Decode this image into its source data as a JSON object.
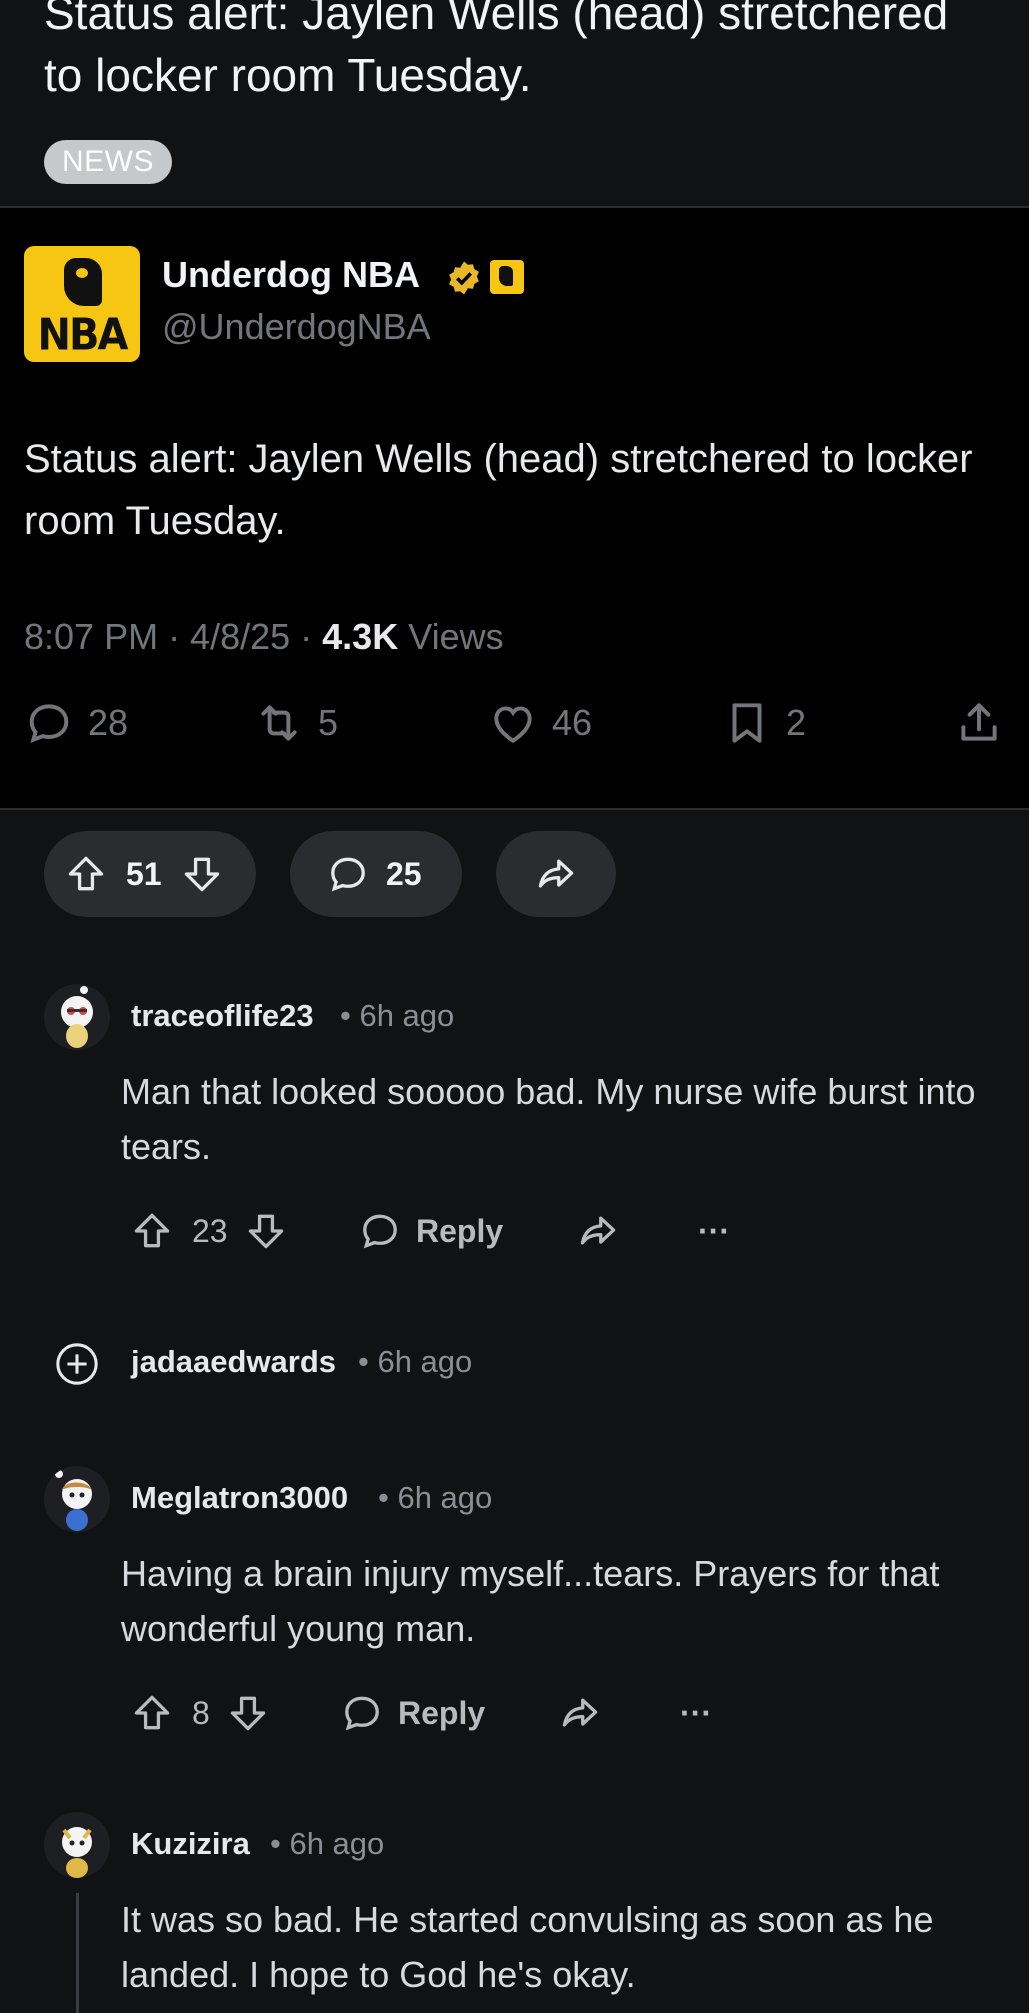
{
  "post": {
    "title": "Status alert: Jaylen Wells (head) stretchered to locker room Tuesday.",
    "flair": "NEWS"
  },
  "embed": {
    "logo_text": "NBA",
    "account_name": "Underdog NBA",
    "handle": "@UnderdogNBA",
    "text": "Status alert: Jaylen Wells (head) stretchered to locker room Tuesday.",
    "time": "8:07 PM · 4/8/25 · ",
    "views_count": "4.3K",
    "views_label": " Views",
    "replies": "28",
    "reposts": "5",
    "likes": "46",
    "bookmarks": "2",
    "colors": {
      "brand": "#f7c613",
      "verified": "#e8b829"
    }
  },
  "post_actions": {
    "votes": "51",
    "comments": "25"
  },
  "comments": [
    {
      "username": "traceoflife23",
      "age": "• 6h ago",
      "text": "Man that looked sooooo bad. My nurse wife burst into tears.",
      "votes": "23",
      "reply_label": "Reply",
      "more": "···"
    },
    {
      "username": "jadaaedwards",
      "age": "• 6h ago",
      "collapsed": true
    },
    {
      "username": "Meglatron3000",
      "age": "• 6h ago",
      "text": "Having a brain injury myself...tears. Prayers for that wonderful young man.",
      "votes": "8",
      "reply_label": "Reply",
      "more": "···"
    },
    {
      "username": "Kuzizira",
      "age": "• 6h ago",
      "text": "It was so bad. He started convulsing as soon as he landed. I hope to God he's okay."
    }
  ]
}
